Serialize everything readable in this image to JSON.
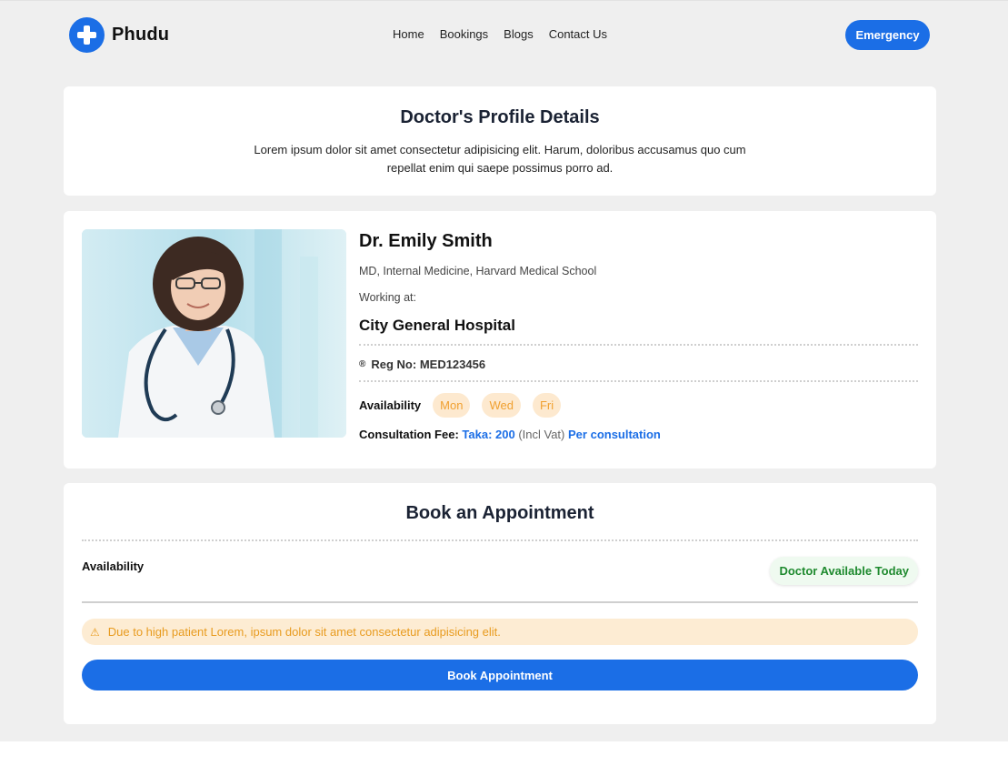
{
  "brand": {
    "name": "Phudu",
    "accent": "#1b6ee6"
  },
  "nav": {
    "links": [
      "Home",
      "Bookings",
      "Blogs",
      "Contact Us"
    ],
    "emergency_label": "Emergency"
  },
  "header": {
    "title": "Doctor's Profile Details",
    "description": "Lorem ipsum dolor sit amet consectetur adipisicing elit. Harum, doloribus accusamus quo cum repellat enim qui saepe possimus porro ad."
  },
  "profile": {
    "name": "Dr. Emily Smith",
    "degree": "MD, Internal Medicine, Harvard Medical School",
    "working_label": "Working at:",
    "hospital": "City General Hospital",
    "reg_icon": "®",
    "reg_no": "Reg No: MED123456",
    "availability_label": "Availability",
    "days": [
      "Mon",
      "Wed",
      "Fri"
    ],
    "fee_label": "Consultation Fee:",
    "fee_amount": "Taka: 200",
    "fee_vat": "(Incl Vat)",
    "fee_per": "Per consultation"
  },
  "booking": {
    "title": "Book an Appointment",
    "availability_label": "Availability",
    "status_badge": "Doctor Available Today",
    "warning": "Due to high patient Lorem, ipsum dolor sit amet consectetur adipisicing elit.",
    "button_label": "Book Appointment"
  }
}
